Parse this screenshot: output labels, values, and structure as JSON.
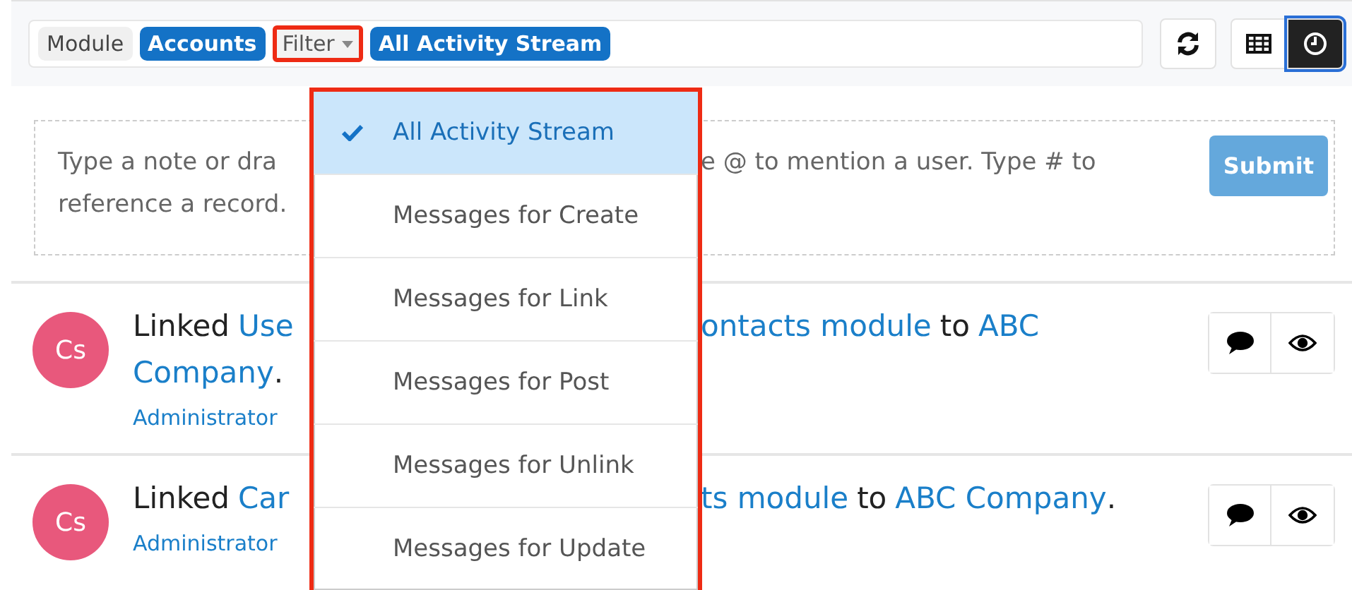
{
  "toolbar": {
    "module_label": "Module",
    "module_value": "Accounts",
    "filter_button": {
      "label": "Filter",
      "highlighted": true
    },
    "filter_value": "All Activity Stream"
  },
  "view_buttons": [
    {
      "kind": "refresh",
      "selected": false
    },
    {
      "kind": "grid",
      "selected": false
    },
    {
      "kind": "clock",
      "selected": true
    }
  ],
  "note": {
    "left_lines": [
      "Type a note or dra",
      "reference a record."
    ],
    "right_lines": [
      "e @ to mention a user. Type # to"
    ],
    "submit": "Submit"
  },
  "posts": [
    {
      "avatar": "Cs",
      "lines": [
        {
          "kind": "main",
          "left": [
            {
              "text": "Linked",
              "link": false
            },
            {
              "text": "Use",
              "link": true
            }
          ],
          "right": [
            {
              "text": "ontacts module",
              "link": true
            },
            {
              "text": "to",
              "link": false
            },
            {
              "text": "ABC",
              "link": true
            }
          ]
        },
        {
          "kind": "main",
          "left": [
            {
              "text": "Company",
              "link": true
            },
            {
              "text": ".",
              "link": false,
              "attached": true
            }
          ]
        },
        {
          "kind": "meta",
          "left": [
            {
              "text": "Administrator",
              "link": true
            }
          ]
        }
      ]
    },
    {
      "avatar": "Cs",
      "lines": [
        {
          "kind": "main",
          "left": [
            {
              "text": "Linked",
              "link": false
            },
            {
              "text": "Car",
              "link": true
            }
          ],
          "right": [
            {
              "text": "ts module",
              "link": true
            },
            {
              "text": "to",
              "link": false
            },
            {
              "text": "ABC Company",
              "link": true
            },
            {
              "text": ".",
              "link": false,
              "attached": true
            }
          ]
        },
        {
          "kind": "meta",
          "left": [
            {
              "text": "Administrator",
              "link": true
            }
          ]
        }
      ]
    }
  ],
  "dropdown": {
    "highlighted": true,
    "items": [
      {
        "label": "All Activity Stream",
        "selected": true
      },
      {
        "label": "Messages for Create",
        "selected": false
      },
      {
        "label": "Messages for Link",
        "selected": false
      },
      {
        "label": "Messages for Post",
        "selected": false
      },
      {
        "label": "Messages for Unlink",
        "selected": false
      },
      {
        "label": "Messages for Update",
        "selected": false
      }
    ]
  }
}
